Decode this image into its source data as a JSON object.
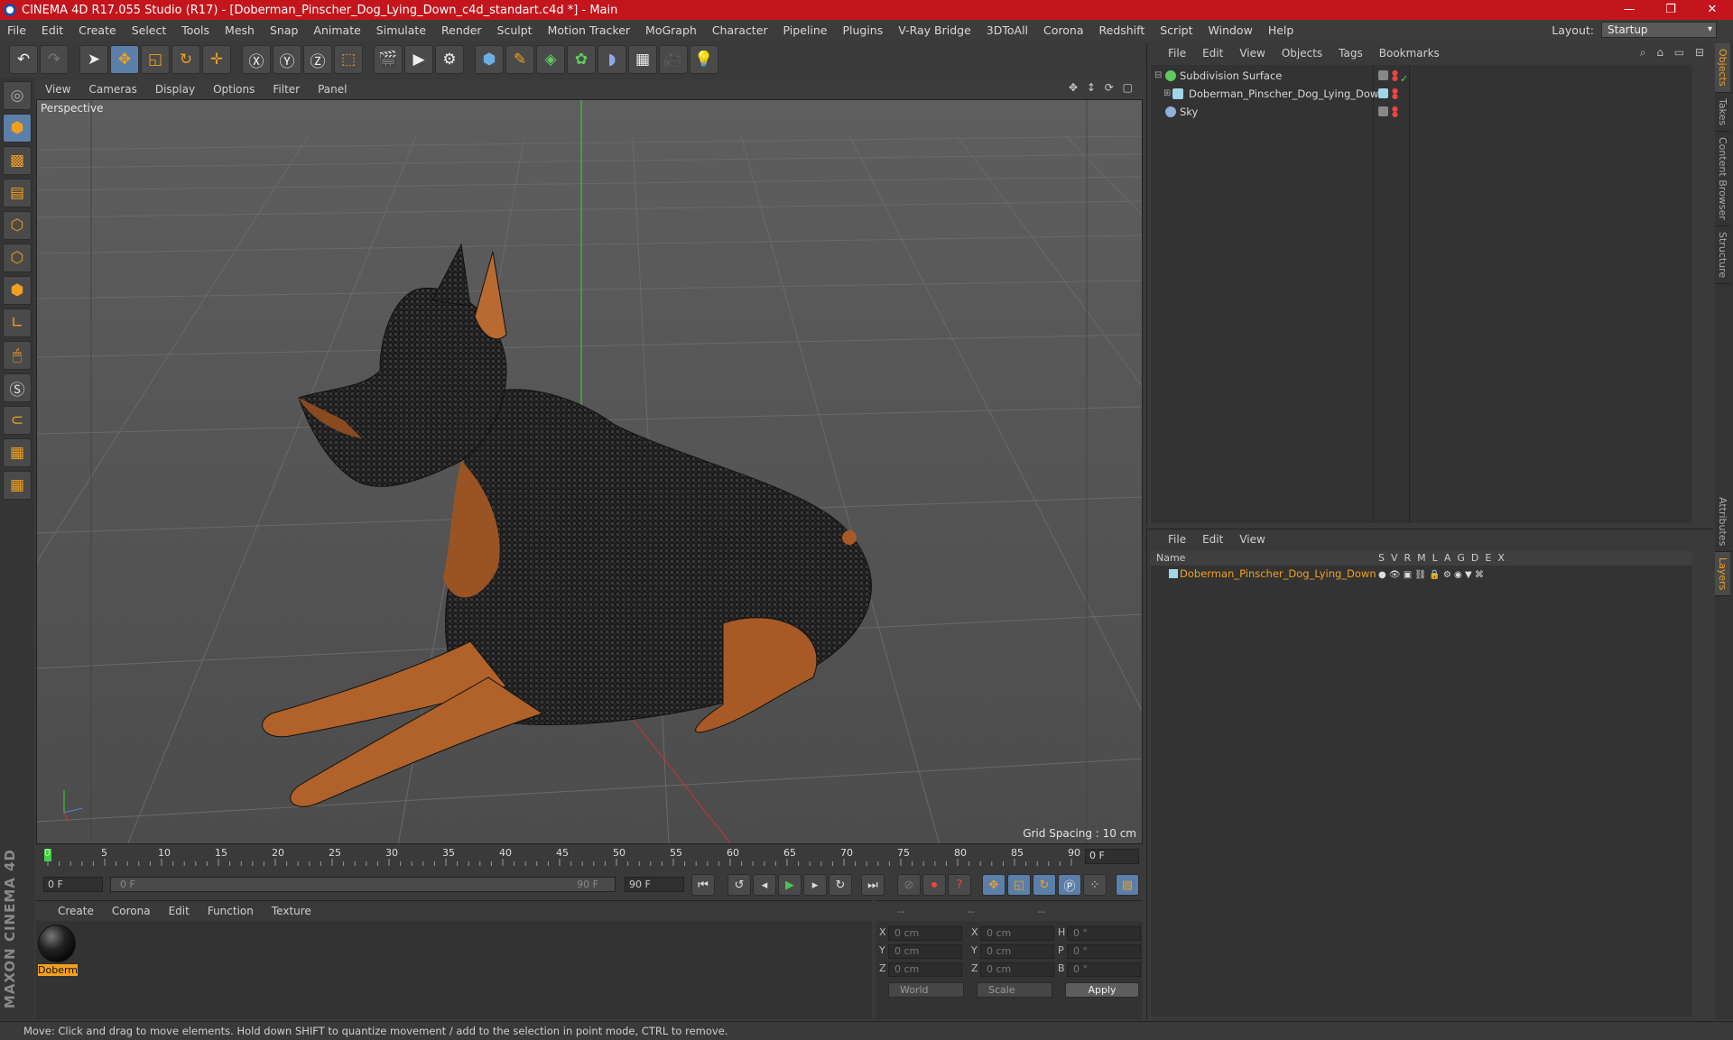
{
  "window": {
    "title": "CINEMA 4D R17.055 Studio (R17) - [Doberman_Pinscher_Dog_Lying_Down_c4d_standart.c4d *] - Main",
    "minimize": "—",
    "maximize": "❐",
    "close": "✕"
  },
  "menubar": {
    "items": [
      "File",
      "Edit",
      "Create",
      "Select",
      "Tools",
      "Mesh",
      "Snap",
      "Animate",
      "Simulate",
      "Render",
      "Sculpt",
      "Motion Tracker",
      "MoGraph",
      "Character",
      "Pipeline",
      "Plugins",
      "V-Ray Bridge",
      "3DToAll",
      "Corona",
      "Redshift",
      "Script",
      "Window",
      "Help"
    ],
    "layout_label": "Layout:",
    "layout_value": "Startup"
  },
  "viewport": {
    "menu": [
      "View",
      "Cameras",
      "Display",
      "Options",
      "Filter",
      "Panel"
    ],
    "label": "Perspective",
    "grid_spacing": "Grid Spacing : 10 cm"
  },
  "timeline": {
    "ticks": [
      "0",
      "5",
      "10",
      "15",
      "20",
      "25",
      "30",
      "35",
      "40",
      "45",
      "50",
      "55",
      "60",
      "65",
      "70",
      "75",
      "80",
      "85",
      "90"
    ],
    "current_frame": "0 F",
    "start_field": "0 F",
    "range_start": "0 F",
    "range_end": "90 F",
    "end_field": "90 F"
  },
  "material_panel": {
    "menu": [
      "Create",
      "Corona",
      "Edit",
      "Function",
      "Texture"
    ],
    "material_name": "Doberm"
  },
  "coords": {
    "header": [
      "--",
      "--",
      "--"
    ],
    "rows": [
      {
        "a": "X",
        "av": "0 cm",
        "b": "X",
        "bv": "0 cm",
        "c": "H",
        "cv": "0 °"
      },
      {
        "a": "Y",
        "av": "0 cm",
        "b": "Y",
        "bv": "0 cm",
        "c": "P",
        "cv": "0 °"
      },
      {
        "a": "Z",
        "av": "0 cm",
        "b": "Z",
        "bv": "0 cm",
        "c": "B",
        "cv": "0 °"
      }
    ],
    "world": "World",
    "scale": "Scale",
    "apply": "Apply"
  },
  "object_manager": {
    "menu": [
      "File",
      "Edit",
      "View",
      "Objects",
      "Tags",
      "Bookmarks"
    ],
    "objects": [
      {
        "name": "Subdivision Surface",
        "color": "#5fc95f"
      },
      {
        "name": "Doberman_Pinscher_Dog_Lying_Down",
        "color": "#9fd7e8"
      },
      {
        "name": "Sky",
        "color": "#8fb0d8"
      }
    ]
  },
  "layer_manager": {
    "menu": [
      "File",
      "Edit",
      "View"
    ],
    "columns_name": "Name",
    "columns": [
      "S",
      "V",
      "R",
      "M",
      "L",
      "A",
      "G",
      "D",
      "E",
      "X"
    ],
    "layers": [
      {
        "name": "Doberman_Pinscher_Dog_Lying_Down"
      }
    ]
  },
  "right_tabs": [
    "Objects",
    "Takes",
    "Content Browser",
    "Structure",
    "Attributes",
    "Layers"
  ],
  "status": "Move: Click and drag to move elements. Hold down SHIFT to quantize movement / add to the selection in point mode, CTRL to remove.",
  "colors": {
    "accent": "#f0a020",
    "title_bar": "#c4151c",
    "selection": "#5b7fa8"
  }
}
